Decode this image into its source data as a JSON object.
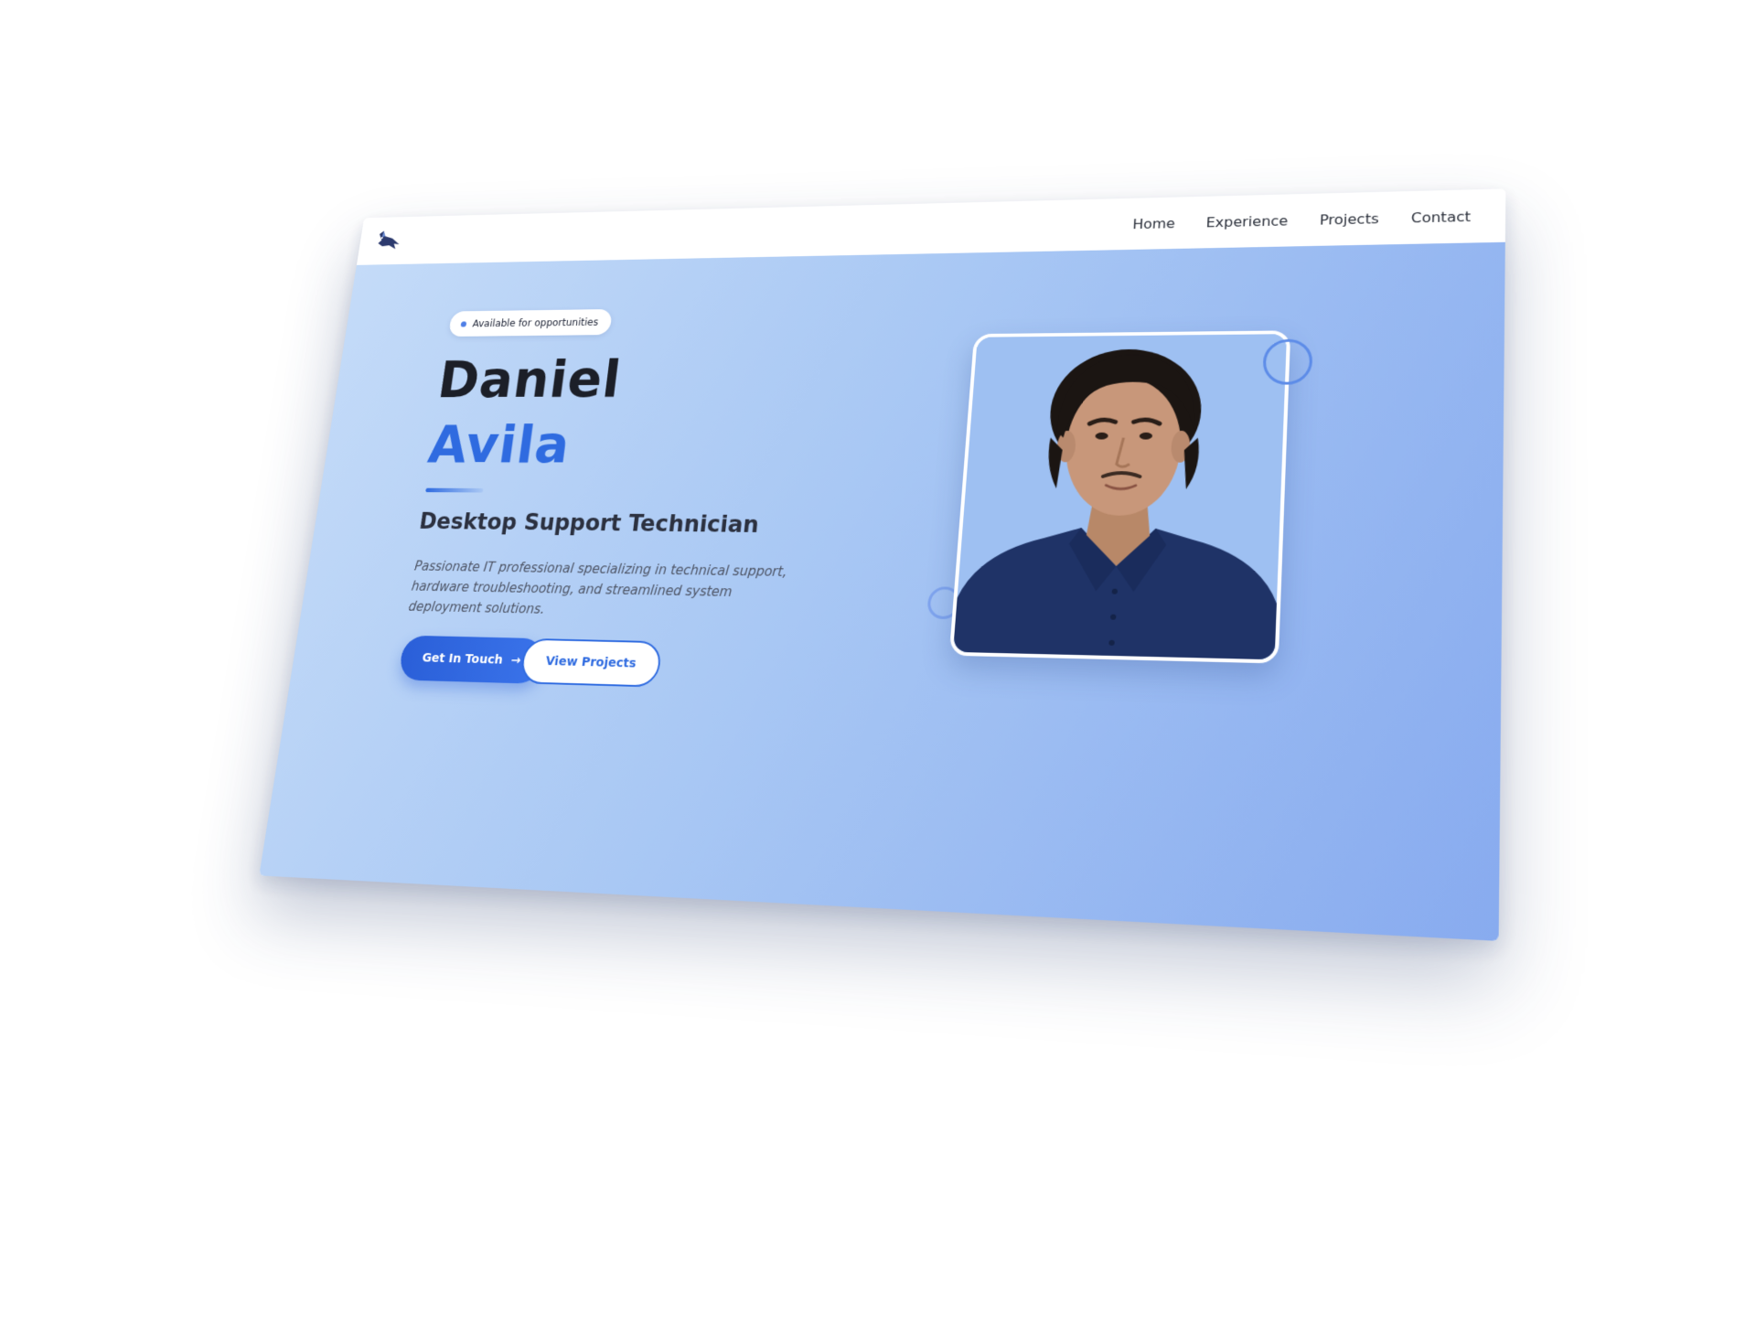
{
  "nav": {
    "logo_icon": "fox-logo-icon",
    "links": [
      "Home",
      "Experience",
      "Projects",
      "Contact"
    ]
  },
  "hero": {
    "badge": "Available for opportunities",
    "first_name": "Daniel",
    "last_name": "Avila",
    "role": "Desktop Support Technician",
    "description": "Passionate IT professional specializing in technical support, hardware troubleshooting, and streamlined system deployment solutions.",
    "primary_button": "Get In Touch",
    "primary_button_icon": "arrow-right-icon",
    "secondary_button": "View Projects",
    "photo_icon": "profile-photo"
  },
  "colors": {
    "accent": "#2f6be0",
    "heading": "#1c1f28",
    "hero_gradient_start": "#c4dbf8",
    "hero_gradient_end": "#88abef"
  }
}
